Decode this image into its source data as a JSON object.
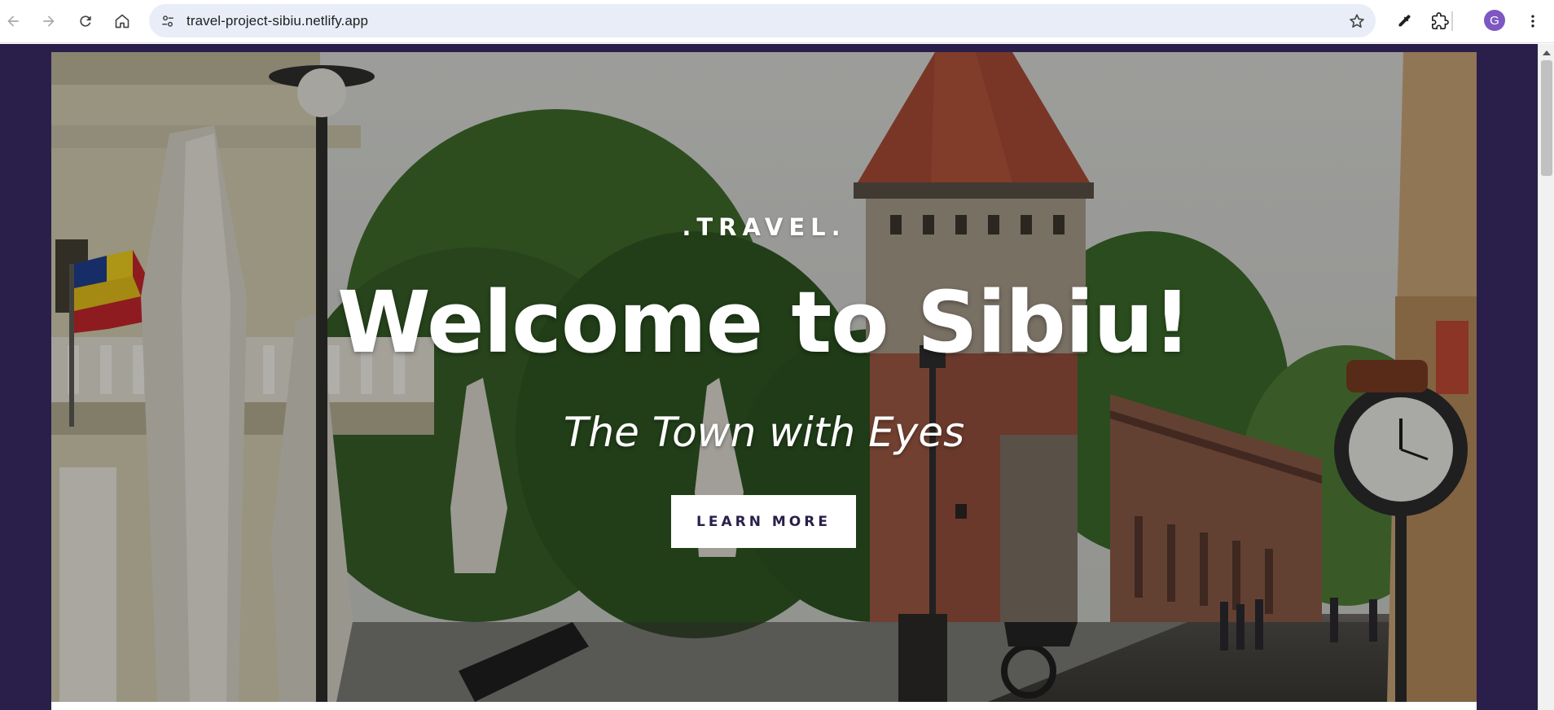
{
  "browser": {
    "url": "travel-project-sibiu.netlify.app",
    "profile_initial": "G",
    "profile_color": "#7e57c2",
    "icons": {
      "back": "arrow-left-icon",
      "forward": "arrow-right-icon",
      "reload": "reload-icon",
      "home": "home-icon",
      "site_info": "tune-icon",
      "bookmark": "star-icon",
      "eyedropper": "eyedropper-icon",
      "extensions": "puzzle-icon",
      "menu": "kebab-menu-icon"
    }
  },
  "hero": {
    "tagline": ".TRAVEL.",
    "headline": "Welcome to Sibiu!",
    "subline": "The Town with Eyes",
    "cta_label": "LEARN MORE"
  },
  "theme": {
    "page_background": "#2a1f4a",
    "cta_text_color": "#2a1f4a",
    "cta_background": "#ffffff"
  }
}
